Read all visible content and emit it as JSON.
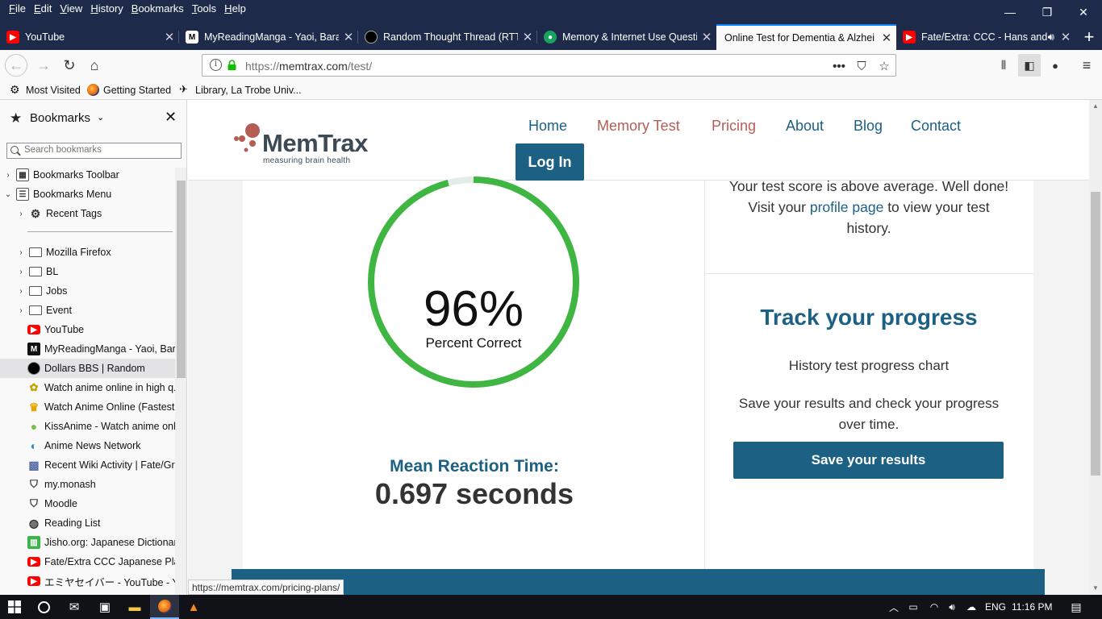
{
  "menubar": {
    "items": [
      "File",
      "Edit",
      "View",
      "History",
      "Bookmarks",
      "Tools",
      "Help"
    ]
  },
  "tabs": [
    {
      "title": "YouTube",
      "icon": "youtube-icon"
    },
    {
      "title": "MyReadingManga - Yaoi, Bara",
      "icon": "mrm-icon"
    },
    {
      "title": "Random Thought Thread (RTT",
      "icon": "dollars-icon"
    },
    {
      "title": "Memory & Internet Use Questi",
      "icon": "survey-icon"
    },
    {
      "title": "Online Test for Dementia & Alzhei",
      "icon": "none"
    },
    {
      "title": "Fate/Extra: CCC - Hans and",
      "icon": "youtube-icon"
    }
  ],
  "urlbar": {
    "prefix": "https://",
    "domain": "memtrax.com",
    "path": "/test/"
  },
  "bookmarks_toolbar": [
    {
      "label": "Most Visited",
      "icon": "gear-icon"
    },
    {
      "label": "Getting Started",
      "icon": "firefox-icon"
    },
    {
      "label": "Library, La Trobe Univ...",
      "icon": "latrobe-icon"
    }
  ],
  "sidebar": {
    "title": "Bookmarks",
    "search_placeholder": "Search bookmarks",
    "items": [
      {
        "label": "Bookmarks Toolbar",
        "twisty": "›",
        "icon": "toolbar-icon"
      },
      {
        "label": "Bookmarks Menu",
        "twisty": "⌄",
        "icon": "menu-icon"
      },
      {
        "label": "Recent Tags",
        "twisty": "›",
        "icon": "gear-icon"
      },
      {
        "label": "Mozilla Firefox",
        "twisty": "›",
        "icon": "folder-icon"
      },
      {
        "label": "BL",
        "twisty": "›",
        "icon": "folder-icon"
      },
      {
        "label": "Jobs",
        "twisty": "›",
        "icon": "folder-icon"
      },
      {
        "label": "Event",
        "twisty": "›",
        "icon": "folder-icon"
      },
      {
        "label": "YouTube",
        "twisty": "",
        "icon": "youtube-icon"
      },
      {
        "label": "MyReadingManga - Yaoi, Bara",
        "twisty": "",
        "icon": "mrm-icon"
      },
      {
        "label": "Dollars BBS | Random",
        "twisty": "",
        "icon": "dollars-icon"
      },
      {
        "label": "Watch anime online in high q...",
        "twisty": "",
        "icon": "anime-icon"
      },
      {
        "label": "Watch Anime Online (Fastest ...",
        "twisty": "",
        "icon": "crown-icon"
      },
      {
        "label": "KissAnime - Watch anime onli...",
        "twisty": "",
        "icon": "kissanime-icon"
      },
      {
        "label": "Anime News Network",
        "twisty": "",
        "icon": "ann-icon"
      },
      {
        "label": "Recent Wiki Activity | Fate/Gra...",
        "twisty": "",
        "icon": "wiki-icon"
      },
      {
        "label": "my.monash",
        "twisty": "",
        "icon": "monash-icon"
      },
      {
        "label": "Moodle",
        "twisty": "",
        "icon": "monash-icon"
      },
      {
        "label": "Reading List",
        "twisty": "",
        "icon": "globe-icon"
      },
      {
        "label": "Jisho.org: Japanese Dictionary",
        "twisty": "",
        "icon": "jisho-icon"
      },
      {
        "label": "Fate/Extra CCC Japanese Playt...",
        "twisty": "",
        "icon": "youtube-icon"
      },
      {
        "label": "エミヤセイバー - YouTube - Y...",
        "twisty": "",
        "icon": "youtube-icon"
      }
    ]
  },
  "site": {
    "logo_word": "MemTrax",
    "logo_tagline": "measuring brain health",
    "nav": [
      "Home",
      "Memory Test",
      "Pricing",
      "About",
      "Blog",
      "Contact"
    ],
    "login": "Log In"
  },
  "results": {
    "percent_correct": 96,
    "percent_text": "96%",
    "percent_label": "Percent Correct",
    "mrt_label": "Mean Reaction Time:",
    "mrt_value": "0.697 seconds"
  },
  "right_panel": {
    "msg_line1": "Your test score is above average. Well done!",
    "msg_line2_pre": "Visit your ",
    "msg_link": "profile page",
    "msg_line2_post": " to view your test history.",
    "track_title": "Track your progress",
    "chart_caption": "History test progress chart",
    "save_desc": "Save your results and check your progress over time.",
    "save_button": "Save your results"
  },
  "status_bar_url": "https://memtrax.com/pricing-plans/",
  "taskbar": {
    "language": "ENG",
    "time": "11:16 PM"
  },
  "colors": {
    "brand_blue": "#1c6084",
    "accent_red": "#b55c55",
    "ring_green": "#3fb542",
    "ring_track": "#e2ede8"
  }
}
